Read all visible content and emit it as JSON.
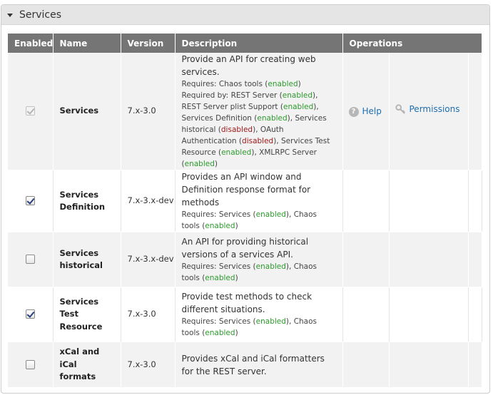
{
  "fieldset": {
    "title": "Services"
  },
  "table": {
    "headers": {
      "enabled": "Enabled",
      "name": "Name",
      "version": "Version",
      "description": "Description",
      "operations": "Operations"
    }
  },
  "rows": [
    {
      "enabled": true,
      "disabled": true,
      "name": "Services",
      "version": "7.x-3.0",
      "description": "Provide an API for creating web services.",
      "requires_label": "Requires: ",
      "requires": [
        {
          "name": "Chaos tools",
          "status": "enabled"
        }
      ],
      "required_by_label": "Required by: ",
      "required_by": [
        {
          "name": "REST Server",
          "status": "enabled"
        },
        {
          "name": "REST Server plist Support",
          "status": "enabled"
        },
        {
          "name": "Services Definition",
          "status": "enabled"
        },
        {
          "name": "Services historical",
          "status": "disabled"
        },
        {
          "name": "OAuth Authentication",
          "status": "disabled"
        },
        {
          "name": "Services Test Resource",
          "status": "enabled"
        },
        {
          "name": "XMLRPC Server",
          "status": "enabled"
        }
      ],
      "ops": {
        "help": "Help",
        "permissions": "Permissions"
      }
    },
    {
      "enabled": true,
      "disabled": false,
      "name": "Services Definition",
      "version": "7.x-3.x-dev",
      "description": "Provides an API window and Definition response format for methods",
      "requires_label": "Requires: ",
      "requires": [
        {
          "name": "Services",
          "status": "enabled"
        },
        {
          "name": "Chaos tools",
          "status": "enabled"
        }
      ]
    },
    {
      "enabled": false,
      "disabled": false,
      "name": "Services historical",
      "version": "7.x-3.x-dev",
      "description": "An API for providing historical versions of a services API.",
      "requires_label": "Requires: ",
      "requires": [
        {
          "name": "Services",
          "status": "enabled"
        },
        {
          "name": "Chaos tools",
          "status": "enabled"
        }
      ]
    },
    {
      "enabled": true,
      "disabled": false,
      "name": "Services Test Resource",
      "version": "7.x-3.0",
      "description": "Provide test methods to check different situations.",
      "requires_label": "Requires: ",
      "requires": [
        {
          "name": "Services",
          "status": "enabled"
        },
        {
          "name": "Chaos tools",
          "status": "enabled"
        }
      ]
    },
    {
      "enabled": false,
      "disabled": false,
      "name": "xCal and iCal formats",
      "version": "7.x-3.0",
      "description": "Provides xCal and iCal formatters for the REST server."
    }
  ],
  "colors": {
    "header_bg": "#757575",
    "link": "#1e6fb0",
    "enabled": "#2c9a2c",
    "disabled": "#a11818"
  },
  "icons": {
    "collapse": "triangle-down-icon",
    "help": "help-icon",
    "permissions": "key-icon"
  }
}
